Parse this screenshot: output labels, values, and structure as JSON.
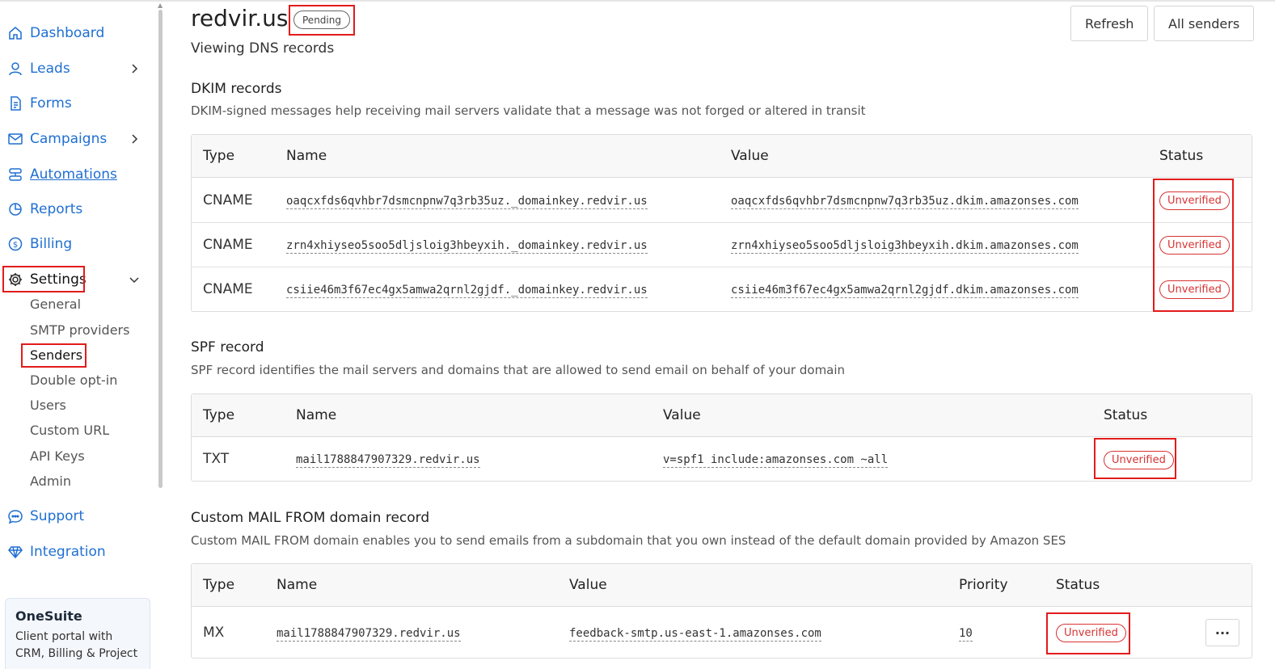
{
  "sidebar": {
    "items": [
      {
        "label": "Dashboard",
        "icon": "home-icon"
      },
      {
        "label": "Leads",
        "icon": "user-icon"
      },
      {
        "label": "Forms",
        "icon": "document-icon"
      },
      {
        "label": "Campaigns",
        "icon": "envelope-icon"
      },
      {
        "label": "Automations",
        "icon": "automation-icon"
      },
      {
        "label": "Reports",
        "icon": "chart-icon"
      },
      {
        "label": "Billing",
        "icon": "dollar-icon"
      },
      {
        "label": "Settings",
        "icon": "gear-icon"
      },
      {
        "label": "Support",
        "icon": "chat-icon"
      },
      {
        "label": "Integration",
        "icon": "diamond-icon"
      }
    ],
    "settings_sub": [
      "General",
      "SMTP providers",
      "Senders",
      "Double opt-in",
      "Users",
      "Custom URL",
      "API Keys",
      "Admin"
    ],
    "promo": {
      "title": "OneSuite",
      "description": "Client portal with CRM, Billing & Project"
    }
  },
  "header": {
    "domain": "redvir.us",
    "status": "Pending",
    "subtitle": "Viewing DNS records",
    "refresh_label": "Refresh",
    "all_senders_label": "All senders"
  },
  "dkim": {
    "title": "DKIM records",
    "description": "DKIM-signed messages help receiving mail servers validate that a message was not forged or altered in transit",
    "columns": [
      "Type",
      "Name",
      "Value",
      "Status"
    ],
    "rows": [
      {
        "type": "CNAME",
        "name": "oaqcxfds6qvhbr7dsmcnpnw7q3rb35uz._domainkey.redvir.us",
        "value": "oaqcxfds6qvhbr7dsmcnpnw7q3rb35uz.dkim.amazonses.com",
        "status": "Unverified"
      },
      {
        "type": "CNAME",
        "name": "zrn4xhiyseo5soo5dljsloig3hbeyxih._domainkey.redvir.us",
        "value": "zrn4xhiyseo5soo5dljsloig3hbeyxih.dkim.amazonses.com",
        "status": "Unverified"
      },
      {
        "type": "CNAME",
        "name": "csiie46m3f67ec4gx5amwa2qrnl2gjdf._domainkey.redvir.us",
        "value": "csiie46m3f67ec4gx5amwa2qrnl2gjdf.dkim.amazonses.com",
        "status": "Unverified"
      }
    ]
  },
  "spf": {
    "title": "SPF record",
    "description": "SPF record identifies the mail servers and domains that are allowed to send email on behalf of your domain",
    "columns": [
      "Type",
      "Name",
      "Value",
      "Status"
    ],
    "rows": [
      {
        "type": "TXT",
        "name": "mail1788847907329.redvir.us",
        "value": "v=spf1 include:amazonses.com ~all",
        "status": "Unverified"
      }
    ]
  },
  "mailfrom": {
    "title": "Custom MAIL FROM domain record",
    "description": "Custom MAIL FROM domain enables you to send emails from a subdomain that you own instead of the default domain provided by Amazon SES",
    "columns": [
      "Type",
      "Name",
      "Value",
      "Priority",
      "Status"
    ],
    "rows": [
      {
        "type": "MX",
        "name": "mail1788847907329.redvir.us",
        "value": "feedback-smtp.us-east-1.amazonses.com",
        "priority": "10",
        "status": "Unverified",
        "more": "···"
      }
    ]
  },
  "colors": {
    "link": "#1f6fd1",
    "unverified": "#d83333",
    "highlight": "#e21b1b"
  }
}
